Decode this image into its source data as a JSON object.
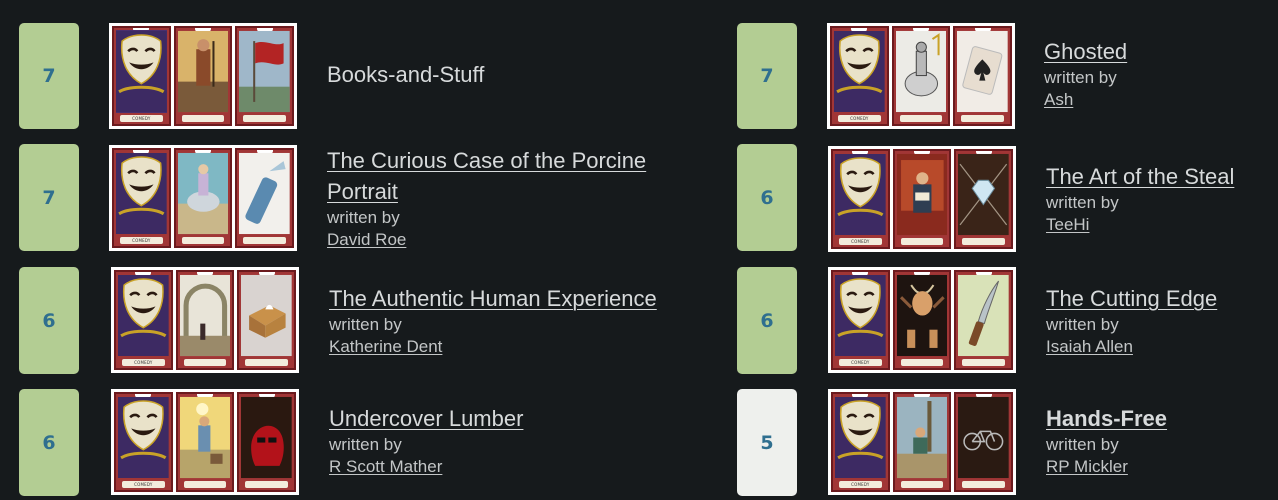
{
  "byline_label": "written by",
  "comedy_label": "COMEDY",
  "left": [
    {
      "score": "7",
      "title": "Books-and-Stuff",
      "author": "",
      "cards": [
        "comedy-mask",
        "traveler",
        "red-flag"
      ]
    },
    {
      "score": "7",
      "title": "The Curious Case of the Porcine Portrait",
      "author": "David Roe",
      "cards": [
        "comedy-mask",
        "rider",
        "spray-can"
      ]
    },
    {
      "score": "6",
      "title": "The Authentic Human Experience",
      "author": "Katherine Dent",
      "cards": [
        "comedy-mask",
        "archway",
        "tissue-box"
      ]
    },
    {
      "score": "6",
      "title": "Undercover Lumber",
      "author": "R Scott Mather",
      "cards": [
        "comedy-mask",
        "woodcutter",
        "red-wig"
      ]
    }
  ],
  "right": [
    {
      "score": "7",
      "title": "Ghosted",
      "author": "Ash",
      "cards": [
        "comedy-mask",
        "knight",
        "ace-of-spades"
      ]
    },
    {
      "score": "6",
      "title": "The Art of the Steal",
      "author": "TeeHi",
      "cards": [
        "comedy-mask",
        "reader",
        "diamond"
      ]
    },
    {
      "score": "6",
      "title": "The Cutting Edge",
      "author": "Isaiah Allen",
      "cards": [
        "comedy-mask",
        "devil",
        "knife"
      ]
    },
    {
      "score": "5",
      "title": "Hands-Free",
      "author": "RP Mickler",
      "cards": [
        "comedy-mask",
        "seated-figure",
        "bicycle"
      ]
    }
  ],
  "colors": {
    "score_green": "#b3cd93",
    "score_light": "#eef0ed",
    "score_text": "#2f6f8f",
    "background": "#161a1c"
  }
}
